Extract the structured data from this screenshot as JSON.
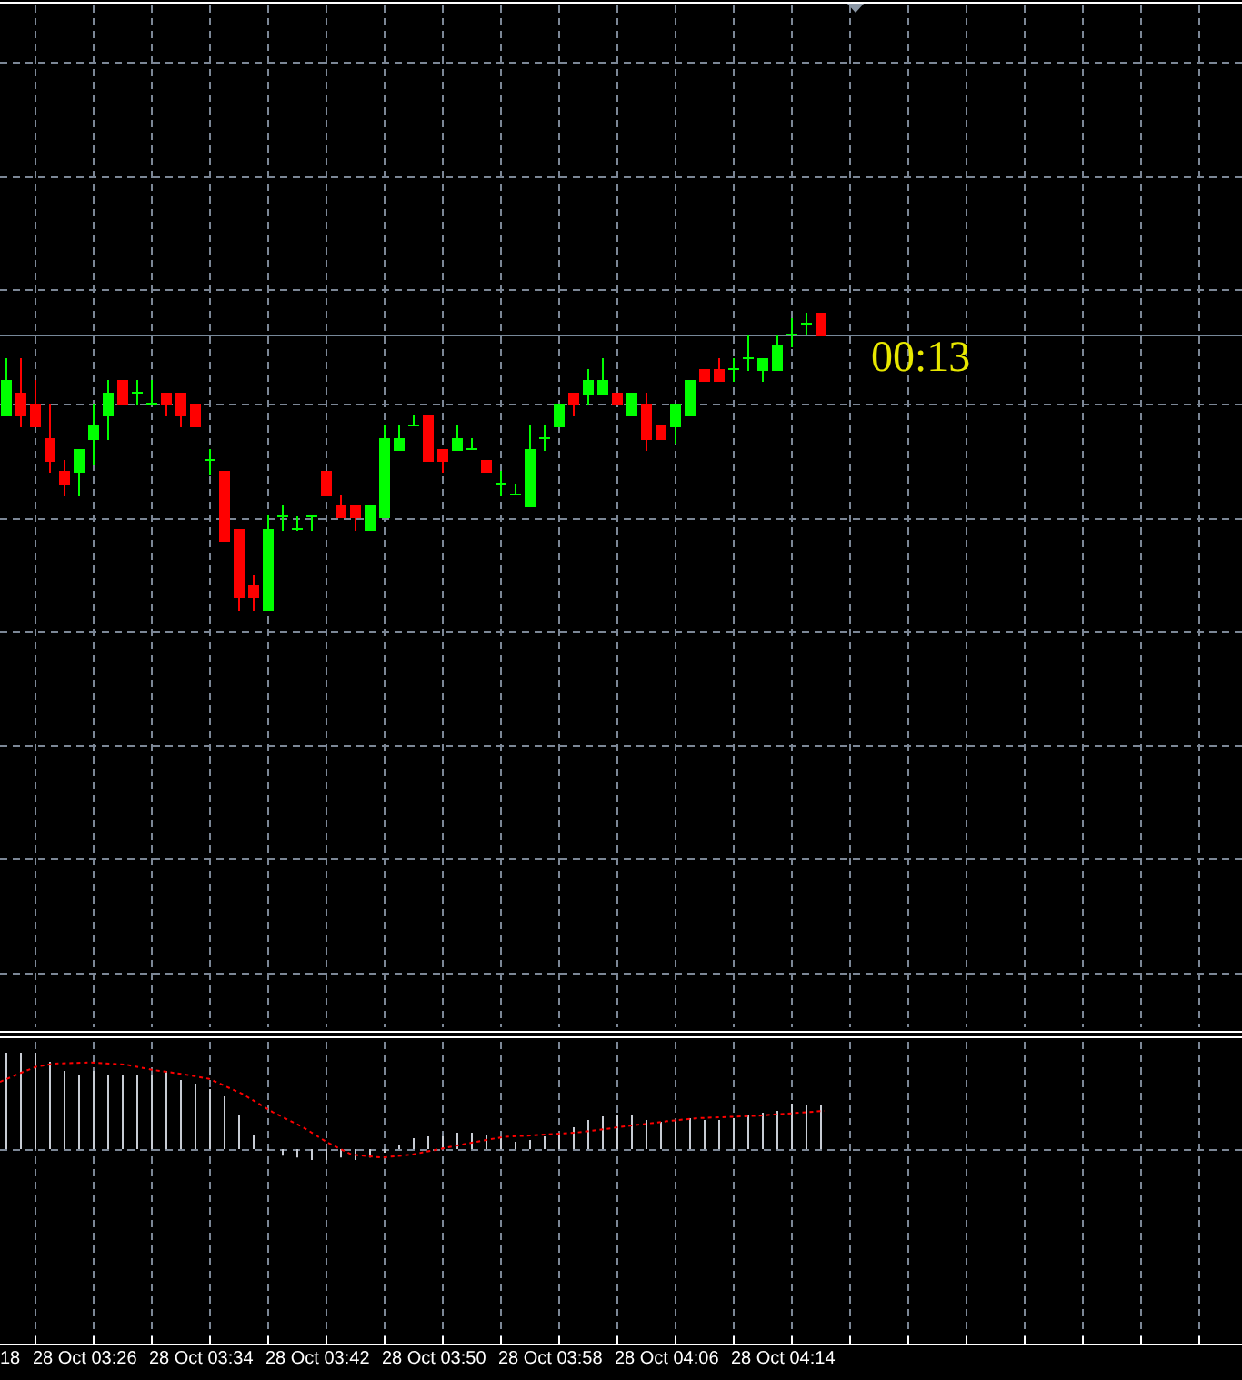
{
  "chart": {
    "countdown": "00:13"
  },
  "time_axis": {
    "labels": [
      "18",
      "28 Oct 03:26",
      "28 Oct 03:34",
      "28 Oct 03:42",
      "28 Oct 03:50",
      "28 Oct 03:58",
      "28 Oct 04:06",
      "28 Oct 04:14"
    ]
  }
}
